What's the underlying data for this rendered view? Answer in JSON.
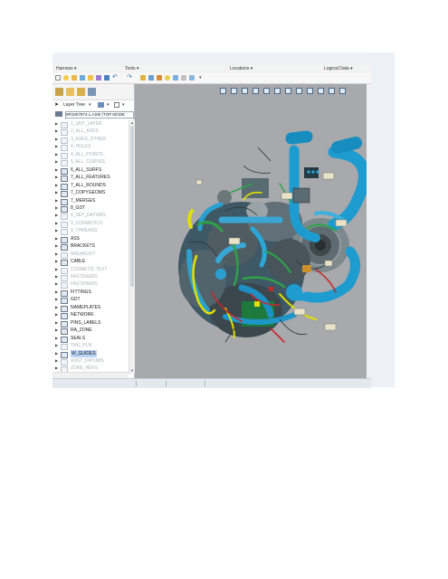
{
  "menubar": {
    "items": [
      "Harness ▾",
      "Tools ▾",
      "Locations ▾",
      "Logical Data ▾"
    ]
  },
  "sidebar": {
    "layer_tree_label": "Layer Tree",
    "model_name": "9R1557874-1.ASM (TOP MODE"
  },
  "layers": [
    {
      "label": "1_UNT_LAYER",
      "state": "dim"
    },
    {
      "label": "2_ALL_AXES",
      "state": "dim"
    },
    {
      "label": "3_AXES_OTHER",
      "state": "dim"
    },
    {
      "label": "4_HOLES",
      "state": "dim"
    },
    {
      "label": "4_ALL_POINTS",
      "state": "dim"
    },
    {
      "label": "5_ALL_CURVES",
      "state": "dim"
    },
    {
      "label": "6_ALL_SURFS",
      "state": "act"
    },
    {
      "label": "7_ALL_FEATURES",
      "state": "act"
    },
    {
      "label": "7_ALL_ROUNDS",
      "state": "act"
    },
    {
      "label": "7_COPYGEOMS",
      "state": "act"
    },
    {
      "label": "7_MERGES",
      "state": "act"
    },
    {
      "label": "8_GDT",
      "state": "act"
    },
    {
      "label": "8_SET_DATUMS",
      "state": "dim"
    },
    {
      "label": "9_COSMETICS",
      "state": "dim"
    },
    {
      "label": "9_THREADS",
      "state": "dim"
    },
    {
      "label": "ASS",
      "state": "act"
    },
    {
      "label": "BRACKETS",
      "state": "act"
    },
    {
      "label": "BREAKOUT",
      "state": "dim"
    },
    {
      "label": "CABLE",
      "state": "act"
    },
    {
      "label": "COSMETIC TEXT",
      "state": "dim"
    },
    {
      "label": "FASTENERS",
      "state": "dim"
    },
    {
      "label": "FASTENERS",
      "state": "dim"
    },
    {
      "label": "FITTINGS",
      "state": "act"
    },
    {
      "label": "GDT",
      "state": "act"
    },
    {
      "label": "NAMEPLATES",
      "state": "act"
    },
    {
      "label": "NETWORK",
      "state": "act"
    },
    {
      "label": "PINS_LABELS",
      "state": "act"
    },
    {
      "label": "RA_ZONE",
      "state": "act"
    },
    {
      "label": "SEALS",
      "state": "act"
    },
    {
      "label": "THG_PLN",
      "state": "dim"
    },
    {
      "label": "W_GUIDES",
      "state": "sel"
    },
    {
      "label": "ASST_DATUMS",
      "state": "dim"
    },
    {
      "label": "ZONE_REFS",
      "state": "dim"
    }
  ],
  "colors": {
    "viewport_bg": "#a7a9ac",
    "duct_blue": "#1e9bcf",
    "wire_yellow": "#e3e000",
    "harness_green": "#2fa14a",
    "wire_red": "#c62828",
    "selection_blue": "#b8d3f5"
  }
}
